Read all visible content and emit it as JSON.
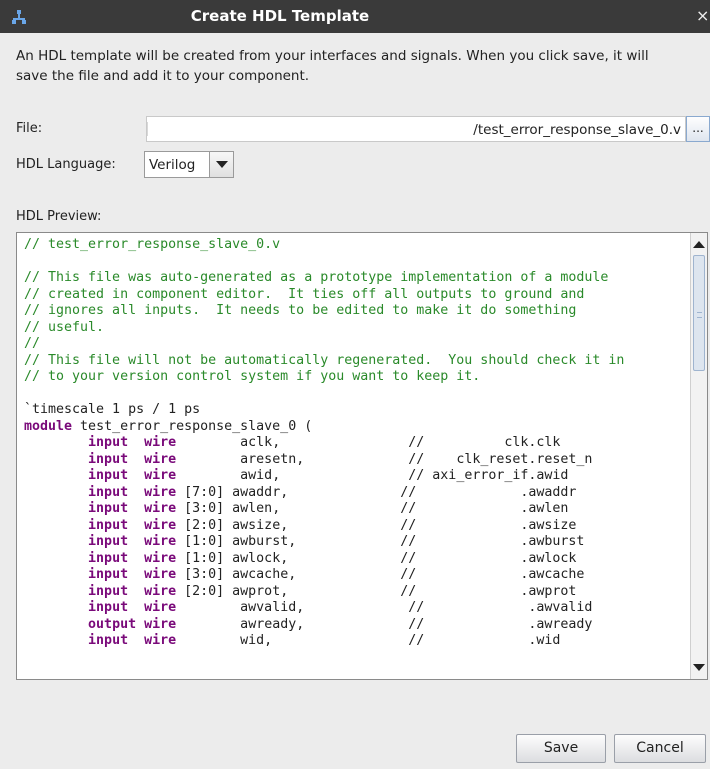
{
  "window": {
    "title": "Create HDL Template",
    "close_glyph": "×",
    "app_icon": "component-icon"
  },
  "description": "An HDL template will be created from your interfaces and signals. When you click save, it will save the file and add it to your component.",
  "file": {
    "label": "File:",
    "value": "/test_error_response_slave_0.v",
    "browse_label": "..."
  },
  "language": {
    "label": "HDL Language:",
    "selected": "Verilog"
  },
  "preview": {
    "label": "HDL Preview:",
    "lines": [
      [
        [
          "c",
          "// test_error_response_slave_0.v"
        ]
      ],
      [
        [
          "t",
          ""
        ]
      ],
      [
        [
          "c",
          "// This file was auto-generated as a prototype implementation of a module"
        ]
      ],
      [
        [
          "c",
          "// created in component editor.  It ties off all outputs to ground and"
        ]
      ],
      [
        [
          "c",
          "// ignores all inputs.  It needs to be edited to make it do something"
        ]
      ],
      [
        [
          "c",
          "// useful."
        ]
      ],
      [
        [
          "c",
          "//"
        ]
      ],
      [
        [
          "c",
          "// This file will not be automatically regenerated.  You should check it in"
        ]
      ],
      [
        [
          "c",
          "// to your version control system if you want to keep it."
        ]
      ],
      [
        [
          "t",
          ""
        ]
      ],
      [
        [
          "t",
          "`timescale 1 ps / 1 ps"
        ]
      ],
      [
        [
          "k",
          "module"
        ],
        [
          "t",
          " test_error_response_slave_0 ("
        ]
      ],
      [
        [
          "t",
          "        "
        ],
        [
          "k",
          "input"
        ],
        [
          "t",
          "  "
        ],
        [
          "k",
          "wire"
        ],
        [
          "t",
          "        aclk,                //          clk.clk"
        ]
      ],
      [
        [
          "t",
          "        "
        ],
        [
          "k",
          "input"
        ],
        [
          "t",
          "  "
        ],
        [
          "k",
          "wire"
        ],
        [
          "t",
          "        aresetn,             //    clk_reset.reset_n"
        ]
      ],
      [
        [
          "t",
          "        "
        ],
        [
          "k",
          "input"
        ],
        [
          "t",
          "  "
        ],
        [
          "k",
          "wire"
        ],
        [
          "t",
          "        awid,                // axi_error_if.awid"
        ]
      ],
      [
        [
          "t",
          "        "
        ],
        [
          "k",
          "input"
        ],
        [
          "t",
          "  "
        ],
        [
          "k",
          "wire"
        ],
        [
          "t",
          " [7:0] awaddr,              //             .awaddr"
        ]
      ],
      [
        [
          "t",
          "        "
        ],
        [
          "k",
          "input"
        ],
        [
          "t",
          "  "
        ],
        [
          "k",
          "wire"
        ],
        [
          "t",
          " [3:0] awlen,               //             .awlen"
        ]
      ],
      [
        [
          "t",
          "        "
        ],
        [
          "k",
          "input"
        ],
        [
          "t",
          "  "
        ],
        [
          "k",
          "wire"
        ],
        [
          "t",
          " [2:0] awsize,              //             .awsize"
        ]
      ],
      [
        [
          "t",
          "        "
        ],
        [
          "k",
          "input"
        ],
        [
          "t",
          "  "
        ],
        [
          "k",
          "wire"
        ],
        [
          "t",
          " [1:0] awburst,             //             .awburst"
        ]
      ],
      [
        [
          "t",
          "        "
        ],
        [
          "k",
          "input"
        ],
        [
          "t",
          "  "
        ],
        [
          "k",
          "wire"
        ],
        [
          "t",
          " [1:0] awlock,              //             .awlock"
        ]
      ],
      [
        [
          "t",
          "        "
        ],
        [
          "k",
          "input"
        ],
        [
          "t",
          "  "
        ],
        [
          "k",
          "wire"
        ],
        [
          "t",
          " [3:0] awcache,             //             .awcache"
        ]
      ],
      [
        [
          "t",
          "        "
        ],
        [
          "k",
          "input"
        ],
        [
          "t",
          "  "
        ],
        [
          "k",
          "wire"
        ],
        [
          "t",
          " [2:0] awprot,              //             .awprot"
        ]
      ],
      [
        [
          "t",
          "        "
        ],
        [
          "k",
          "input"
        ],
        [
          "t",
          "  "
        ],
        [
          "k",
          "wire"
        ],
        [
          "t",
          "        awvalid,             //             .awvalid"
        ]
      ],
      [
        [
          "t",
          "        "
        ],
        [
          "k",
          "output"
        ],
        [
          "t",
          " "
        ],
        [
          "k",
          "wire"
        ],
        [
          "t",
          "        awready,             //             .awready"
        ]
      ],
      [
        [
          "t",
          "        "
        ],
        [
          "k",
          "input"
        ],
        [
          "t",
          "  "
        ],
        [
          "k",
          "wire"
        ],
        [
          "t",
          "        wid,                 //             .wid"
        ]
      ]
    ]
  },
  "buttons": {
    "save": "Save",
    "cancel": "Cancel"
  }
}
